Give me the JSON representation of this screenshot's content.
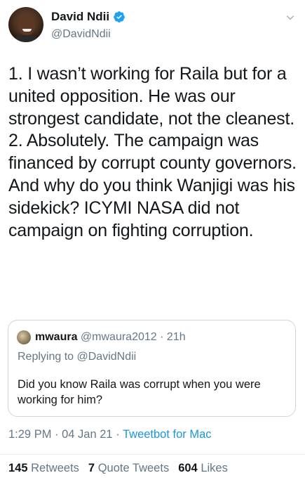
{
  "author": {
    "display_name": "David Ndii",
    "handle": "@DavidNdii",
    "verified": true
  },
  "tweet": {
    "paragraphs": [
      "1. I wasn’t working for Raila but for a united opposition. He was our strongest candidate, not the cleanest.",
      "2. Absolutely. The campaign was financed by corrupt county governors. And why do you think Wanjigi was his sidekick? ICYMI NASA did not campaign on fighting corruption."
    ]
  },
  "quoted_tweet": {
    "display_name": "mwaura",
    "handle": "@mwaura2012",
    "separator": " · ",
    "time_ago": "21h",
    "replying_prefix": "Replying to ",
    "replying_to": "@DavidNdii",
    "text": "Did you know Raila was corrupt when you were working for him?"
  },
  "meta": {
    "time": "1:29 PM",
    "separator": " · ",
    "date": "04 Jan 21",
    "source": "Tweetbot for Mac"
  },
  "stats": {
    "retweets_count": "145",
    "retweets_label": "Retweets",
    "quotes_count": "7",
    "quotes_label": "Quote Tweets",
    "likes_count": "604",
    "likes_label": "Likes"
  },
  "colors": {
    "link": "#1b95e0",
    "secondary_text": "#657786",
    "border": "#ccd6dd",
    "verified_badge": "#1da1f2"
  },
  "icons": [
    "verified-badge-icon",
    "chevron-down-icon"
  ]
}
